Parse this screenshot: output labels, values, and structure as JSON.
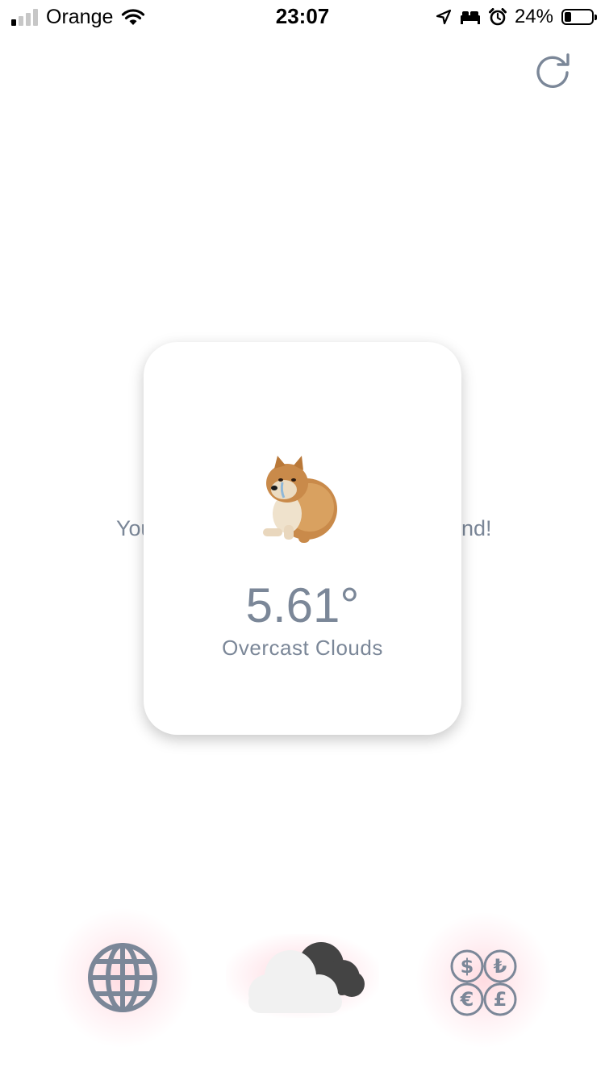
{
  "status_bar": {
    "carrier": "Orange",
    "time": "23:07",
    "battery_percent": "24%",
    "battery_level": 0.24,
    "signal_bars_active": 1,
    "signal_bars_total": 4,
    "icons": [
      "wifi-icon",
      "location-arrow-icon",
      "bed-icon",
      "alarm-clock-icon",
      "battery-icon"
    ]
  },
  "header": {
    "refresh_icon": "refresh-icon"
  },
  "background_message": {
    "left_fragment": "You",
    "right_fragment": "nd!"
  },
  "weather_card": {
    "image": "crying-doge-image",
    "temperature": "5.61°",
    "description": "Overcast Clouds"
  },
  "bottom_nav": {
    "items": [
      {
        "icon": "globe-icon",
        "active": false
      },
      {
        "icon": "cloud-icon",
        "active": true
      },
      {
        "icon": "currency-icon",
        "active": false
      }
    ],
    "accent_colors": {
      "icon": "#7b8798",
      "glow": "#ffc7cf",
      "cloud_light": "#f2f2f2",
      "cloud_dark": "#424242"
    }
  }
}
